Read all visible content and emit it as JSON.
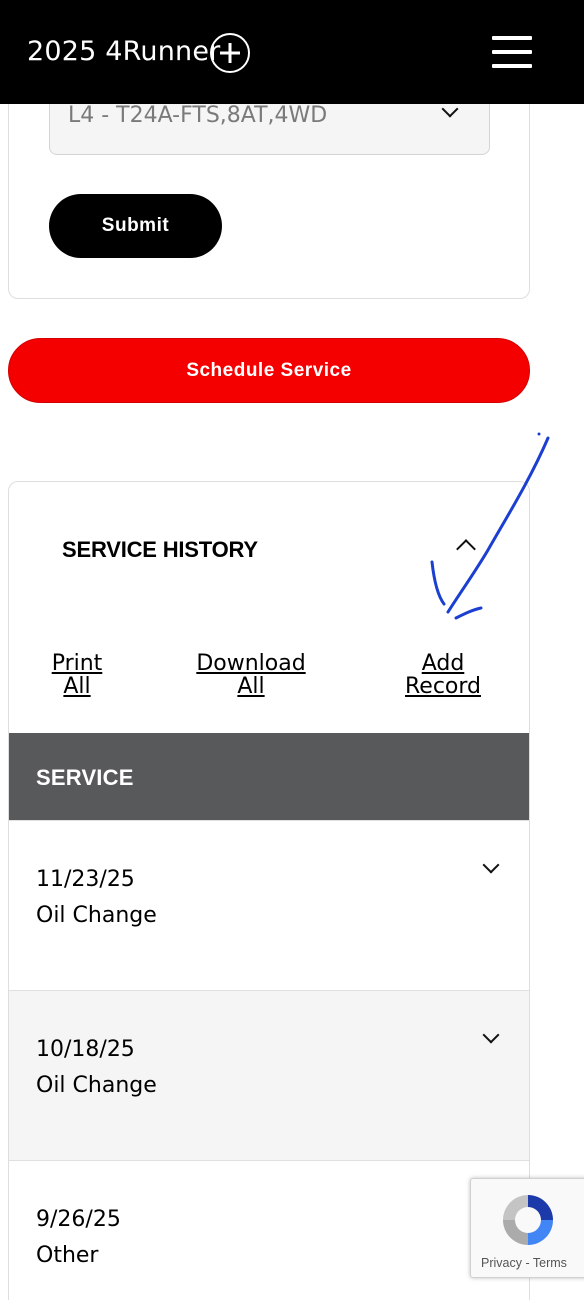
{
  "header": {
    "title": "2025 4Runner",
    "add_icon": "plus-circle-icon",
    "menu_icon": "hamburger-menu-icon"
  },
  "engine_select": {
    "value": "L4 - T24A-FTS,8AT,4WD"
  },
  "buttons": {
    "submit": "Submit",
    "schedule_service": "Schedule Service"
  },
  "service_history": {
    "title": "SERVICE HISTORY",
    "actions": {
      "print": [
        "Print",
        "All"
      ],
      "download": [
        "Download",
        "All"
      ],
      "add": [
        "Add",
        "Record"
      ]
    },
    "column_header": "SERVICE",
    "records": [
      {
        "date": "11/23/25",
        "type": "Oil Change"
      },
      {
        "date": "10/18/25",
        "type": "Oil Change"
      },
      {
        "date": "9/26/25",
        "type": "Other"
      }
    ]
  },
  "recaptcha": {
    "text": "Privacy - Terms"
  },
  "colors": {
    "header_bg": "#000000",
    "schedule_red": "#f50000",
    "table_header_gray": "#58595b",
    "alt_row": "#f5f5f5",
    "annotation_blue": "#1a3fd1"
  }
}
